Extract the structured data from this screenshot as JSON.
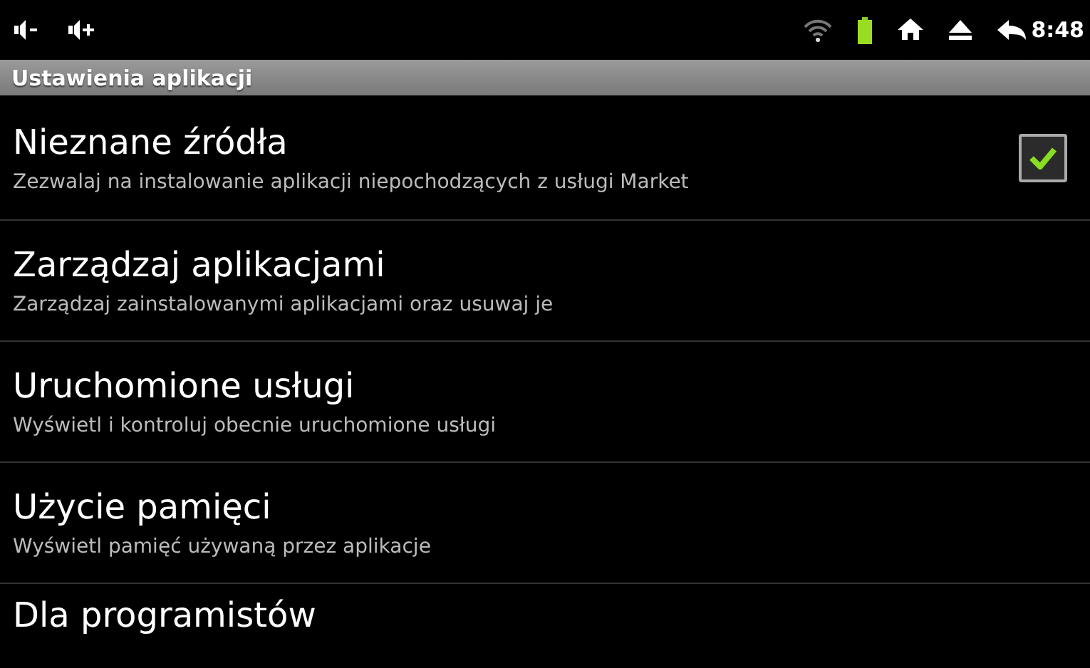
{
  "status_bar": {
    "time": "8:48"
  },
  "title_bar": {
    "title": "Ustawienia aplikacji"
  },
  "items": [
    {
      "kind": "checkbox",
      "title": "Nieznane źródła",
      "summary": "Zezwalaj na instalowanie aplikacji niepochodzących z usługi Market",
      "checked": true
    },
    {
      "kind": "plain",
      "title": "Zarządzaj aplikacjami",
      "summary": "Zarządzaj zainstalowanymi aplikacjami oraz usuwaj je"
    },
    {
      "kind": "plain",
      "title": "Uruchomione usługi",
      "summary": "Wyświetl i kontroluj obecnie uruchomione usługi"
    },
    {
      "kind": "plain",
      "title": "Użycie pamięci",
      "summary": "Wyświetl pamięć używaną przez aplikacje"
    },
    {
      "kind": "plain",
      "title": "Dla programistów"
    }
  ]
}
